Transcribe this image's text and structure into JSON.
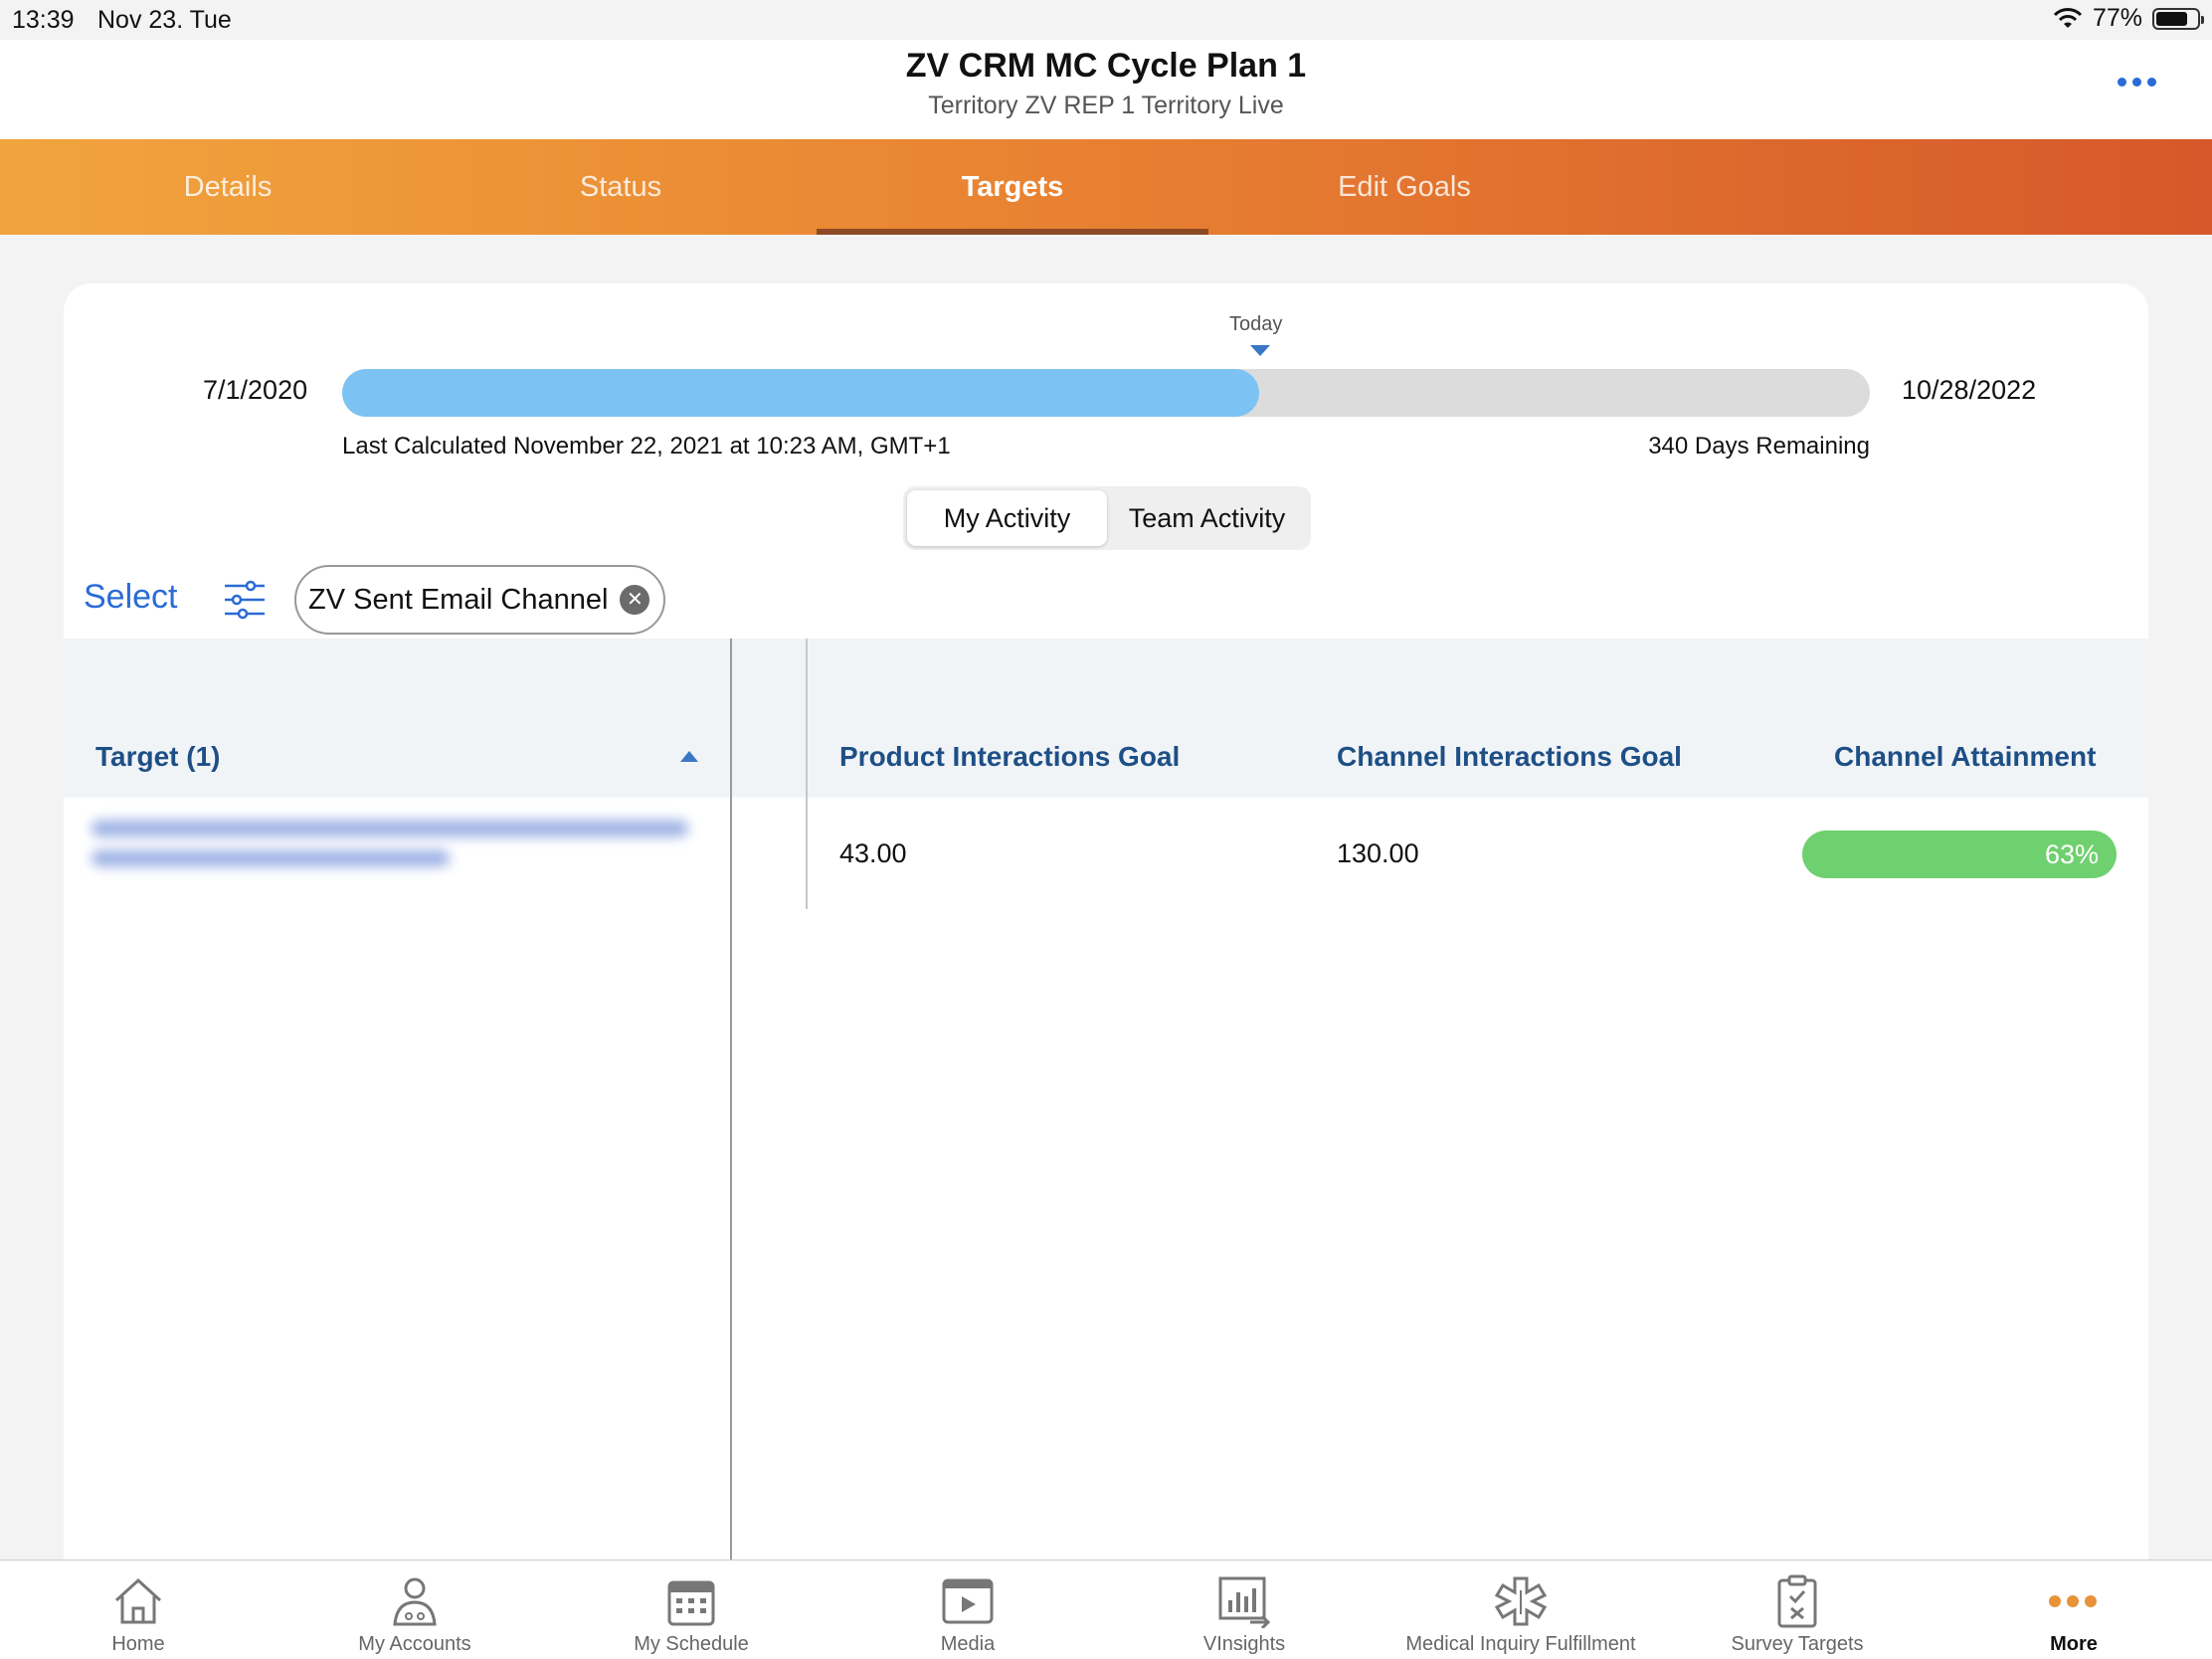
{
  "status_bar": {
    "time": "13:39",
    "date": "Nov 23. Tue",
    "battery": "77%"
  },
  "header": {
    "title": "ZV CRM MC Cycle Plan 1",
    "subtitle": "Territory ZV REP 1 Territory Live"
  },
  "tabs": [
    {
      "label": "Details"
    },
    {
      "label": "Status"
    },
    {
      "label": "Targets",
      "active": true
    },
    {
      "label": "Edit Goals"
    }
  ],
  "timeline": {
    "start_date": "7/1/2020",
    "end_date": "10/28/2022",
    "today_label": "Today",
    "progress_fraction": 0.6,
    "last_calculated": "Last Calculated November 22, 2021 at 10:23 AM, GMT+1",
    "days_remaining": "340 Days Remaining"
  },
  "activity_toggle": {
    "my_activity": "My Activity",
    "team_activity": "Team Activity",
    "selected": "My Activity"
  },
  "filter": {
    "select_label": "Select",
    "chip_label": "ZV Sent Email Channel"
  },
  "table": {
    "target_header": "Target (1)",
    "columns": [
      "Product Interactions Goal",
      "Channel Interactions Goal",
      "Channel Attainment"
    ],
    "rows": [
      {
        "product_goal": "43.00",
        "channel_goal": "130.00",
        "attainment": "63%",
        "attainment_fraction": 0.63
      }
    ]
  },
  "bottom_nav": [
    {
      "label": "Home",
      "icon": "home-icon"
    },
    {
      "label": "My Accounts",
      "icon": "accounts-icon"
    },
    {
      "label": "My Schedule",
      "icon": "calendar-icon"
    },
    {
      "label": "Media",
      "icon": "media-icon"
    },
    {
      "label": "VInsights",
      "icon": "insights-icon"
    },
    {
      "label": "Medical Inquiry Fulfillment",
      "icon": "medical-icon"
    },
    {
      "label": "Survey Targets",
      "icon": "survey-icon"
    },
    {
      "label": "More",
      "icon": "more-icon",
      "active": true
    }
  ],
  "colors": {
    "accent_blue": "#2a6bd6",
    "tab_gradient_start": "#f1a43e",
    "tab_gradient_end": "#d6582a",
    "progress_fill": "#7cc3f3",
    "attainment_green": "#6fd06f"
  }
}
